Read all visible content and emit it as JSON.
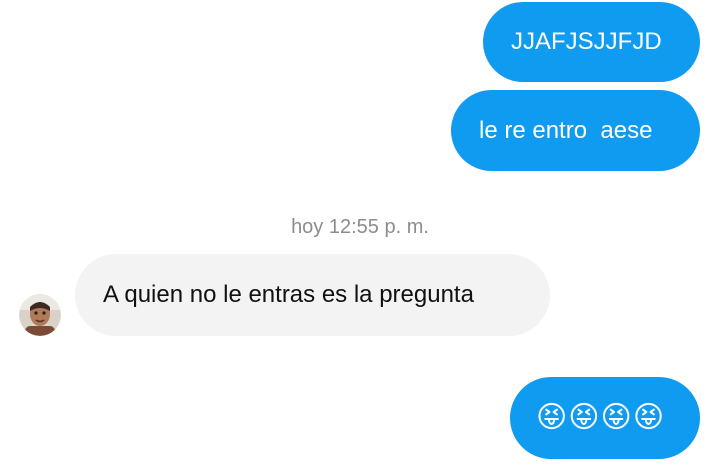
{
  "conversation": {
    "messages": [
      {
        "direction": "outgoing",
        "text": "JJAFJSJJFJD"
      },
      {
        "direction": "outgoing",
        "text": "le re entro  aese"
      },
      {
        "direction": "incoming",
        "text": "A quien no le entras es la pregunta"
      },
      {
        "direction": "outgoing",
        "text": "😝😝😝😝"
      }
    ],
    "timestamp": "hoy 12:55 p. m.",
    "contact_avatar_icon": "profile-photo"
  },
  "colors": {
    "outgoing_bubble": "#0f9bf0",
    "incoming_bubble": "#f3f3f4",
    "timestamp_text": "#8a8d91"
  }
}
